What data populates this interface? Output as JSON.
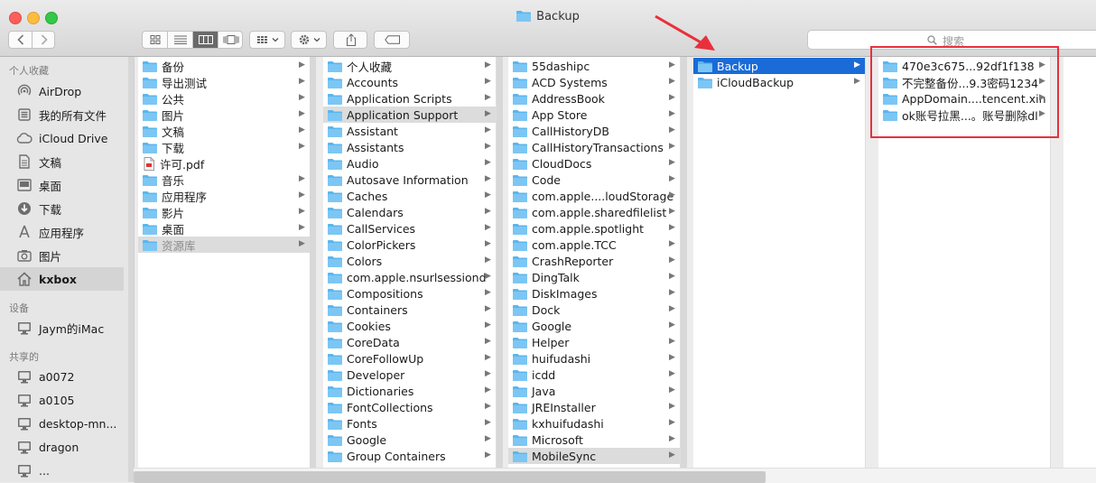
{
  "window": {
    "title": "Backup"
  },
  "toolbar": {
    "back_icon": "chevron-left-icon",
    "forward_icon": "chevron-right-icon",
    "view_modes": [
      "icon-view-icon",
      "list-view-icon",
      "column-view-icon",
      "cover-flow-icon"
    ],
    "arrange_icon": "arrange-grid-icon",
    "action_icon": "gear-icon",
    "share_icon": "share-icon",
    "tags_icon": "tag-icon",
    "search_placeholder": "搜索"
  },
  "sidebar": {
    "favorites_header": "个人收藏",
    "favorites": [
      {
        "label": "AirDrop",
        "icon": "airdrop-icon"
      },
      {
        "label": "我的所有文件",
        "icon": "all-files-icon"
      },
      {
        "label": "iCloud Drive",
        "icon": "cloud-icon"
      },
      {
        "label": "文稿",
        "icon": "document-icon"
      },
      {
        "label": "桌面",
        "icon": "desktop-icon"
      },
      {
        "label": "下载",
        "icon": "download-icon"
      },
      {
        "label": "应用程序",
        "icon": "applications-icon"
      },
      {
        "label": "图片",
        "icon": "camera-icon"
      },
      {
        "label": "kxbox",
        "icon": "home-icon"
      }
    ],
    "devices_header": "设备",
    "devices": [
      {
        "label": "Jaym的iMac",
        "icon": "imac-icon"
      }
    ],
    "shared_header": "共享的",
    "shared": [
      {
        "label": "a0072",
        "icon": "computer-icon"
      },
      {
        "label": "a0105",
        "icon": "computer-icon"
      },
      {
        "label": "desktop-mn...",
        "icon": "computer-icon"
      },
      {
        "label": "dragon",
        "icon": "computer-icon"
      },
      {
        "label": "...",
        "icon": "computer-icon"
      }
    ]
  },
  "columns": [
    {
      "items": [
        {
          "label": "备份",
          "icon": "folder-icon",
          "arrow": true
        },
        {
          "label": "导出测试",
          "icon": "folder-icon",
          "arrow": true
        },
        {
          "label": "公共",
          "icon": "folder-icon",
          "arrow": true
        },
        {
          "label": "图片",
          "icon": "folder-icon",
          "arrow": true
        },
        {
          "label": "文稿",
          "icon": "folder-icon",
          "arrow": true
        },
        {
          "label": "下载",
          "icon": "folder-icon",
          "arrow": true
        },
        {
          "label": "许可.pdf",
          "icon": "file-icon",
          "arrow": false
        },
        {
          "label": "音乐",
          "icon": "folder-icon",
          "arrow": true
        },
        {
          "label": "应用程序",
          "icon": "folder-icon",
          "arrow": true
        },
        {
          "label": "影片",
          "icon": "folder-icon",
          "arrow": true
        },
        {
          "label": "桌面",
          "icon": "folder-icon",
          "arrow": true
        },
        {
          "label": "资源库",
          "icon": "folder-icon",
          "arrow": true,
          "state": "hl",
          "dim": true
        }
      ]
    },
    {
      "items": [
        {
          "label": "个人收藏",
          "arrow": true
        },
        {
          "label": "Accounts",
          "arrow": true
        },
        {
          "label": "Application Scripts",
          "arrow": true
        },
        {
          "label": "Application Support",
          "arrow": true,
          "state": "hl"
        },
        {
          "label": "Assistant",
          "arrow": true
        },
        {
          "label": "Assistants",
          "arrow": true
        },
        {
          "label": "Audio",
          "arrow": true
        },
        {
          "label": "Autosave Information",
          "arrow": true
        },
        {
          "label": "Caches",
          "arrow": true
        },
        {
          "label": "Calendars",
          "arrow": true
        },
        {
          "label": "CallServices",
          "arrow": true
        },
        {
          "label": "ColorPickers",
          "arrow": true
        },
        {
          "label": "Colors",
          "arrow": true
        },
        {
          "label": "com.apple.nsurlsessiond",
          "arrow": true
        },
        {
          "label": "Compositions",
          "arrow": true
        },
        {
          "label": "Containers",
          "arrow": true
        },
        {
          "label": "Cookies",
          "arrow": true
        },
        {
          "label": "CoreData",
          "arrow": true
        },
        {
          "label": "CoreFollowUp",
          "arrow": true
        },
        {
          "label": "Developer",
          "arrow": true
        },
        {
          "label": "Dictionaries",
          "arrow": true
        },
        {
          "label": "FontCollections",
          "arrow": true
        },
        {
          "label": "Fonts",
          "arrow": true
        },
        {
          "label": "Google",
          "arrow": true
        },
        {
          "label": "Group Containers",
          "arrow": true
        }
      ]
    },
    {
      "items": [
        {
          "label": "55dashipc",
          "arrow": true
        },
        {
          "label": "ACD Systems",
          "arrow": true
        },
        {
          "label": "AddressBook",
          "arrow": true
        },
        {
          "label": "App Store",
          "arrow": true
        },
        {
          "label": "CallHistoryDB",
          "arrow": true
        },
        {
          "label": "CallHistoryTransactions",
          "arrow": true
        },
        {
          "label": "CloudDocs",
          "arrow": true
        },
        {
          "label": "Code",
          "arrow": true
        },
        {
          "label": "com.apple....loudStorage",
          "arrow": true
        },
        {
          "label": "com.apple.sharedfilelist",
          "arrow": true
        },
        {
          "label": "com.apple.spotlight",
          "arrow": true
        },
        {
          "label": "com.apple.TCC",
          "arrow": true
        },
        {
          "label": "CrashReporter",
          "arrow": true
        },
        {
          "label": "DingTalk",
          "arrow": true
        },
        {
          "label": "DiskImages",
          "arrow": true
        },
        {
          "label": "Dock",
          "arrow": true
        },
        {
          "label": "Google",
          "arrow": true
        },
        {
          "label": "Helper",
          "arrow": true
        },
        {
          "label": "huifudashi",
          "arrow": true
        },
        {
          "label": "icdd",
          "arrow": true
        },
        {
          "label": "Java",
          "arrow": true
        },
        {
          "label": "JREInstaller",
          "arrow": true
        },
        {
          "label": "kxhuifudashi",
          "arrow": true
        },
        {
          "label": "Microsoft",
          "arrow": true
        },
        {
          "label": "MobileSync",
          "arrow": true,
          "state": "hl"
        }
      ]
    },
    {
      "items": [
        {
          "label": "Backup",
          "arrow": true,
          "state": "sel"
        },
        {
          "label": "iCloudBackup",
          "arrow": true
        }
      ]
    },
    {
      "items": [
        {
          "label": "470e3c675...92df1f138",
          "arrow": true
        },
        {
          "label": "不完整备份...9.3密码1234",
          "arrow": true
        },
        {
          "label": "AppDomain....tencent.xin",
          "arrow": true
        },
        {
          "label": "ok账号拉黑...。账号删除dl",
          "arrow": true
        }
      ]
    }
  ],
  "colors": {
    "folder": "#5ab6ee",
    "selection": "#1a6bd8",
    "annotation": "#e8303c"
  }
}
